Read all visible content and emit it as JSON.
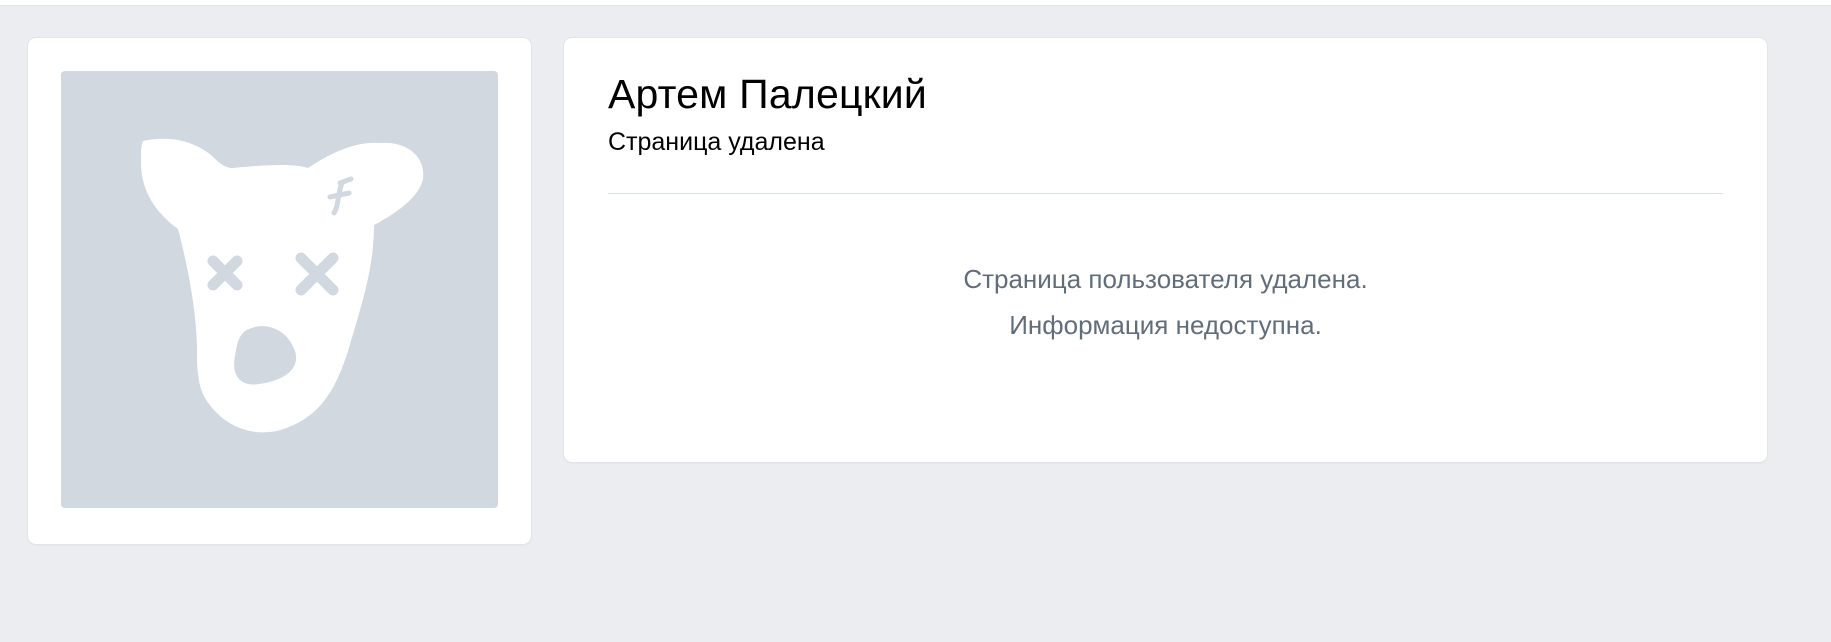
{
  "profile": {
    "name": "Артем Палецкий",
    "status": "Страница удалена",
    "message_lines": [
      "Страница пользователя удалена.",
      "Информация недоступна."
    ]
  },
  "avatar": {
    "icon": "deactivated-dog-icon",
    "background_color": "#d1d8e0",
    "foreground_color": "#ffffff"
  },
  "colors": {
    "page_background": "#ebedf0",
    "card_background": "#ffffff",
    "message_text": "#626d7a"
  }
}
